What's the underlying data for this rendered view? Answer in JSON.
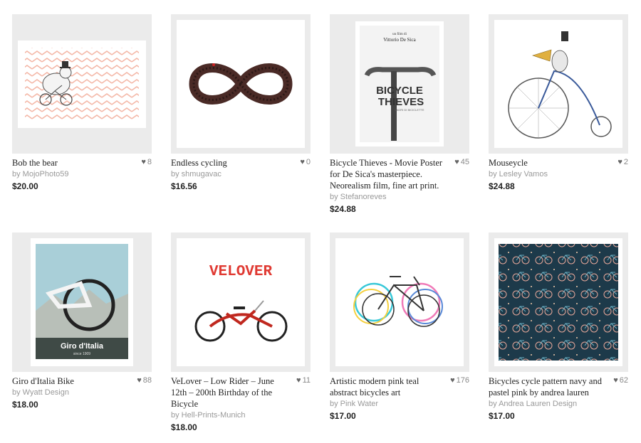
{
  "products": [
    {
      "title": "Bob the bear",
      "artist": "by MojoPhoto59",
      "price": "$20.00",
      "likes": "8",
      "heart_icon": "heart-icon"
    },
    {
      "title": "Endless cycling",
      "artist": "by shmugavac",
      "price": "$16.56",
      "likes": "0",
      "heart_icon": "heart-icon"
    },
    {
      "title": "Bicycle Thieves - Movie Poster for De Sica's masterpiece. Neorealism film, fine art print.",
      "artist": "by Stefanoreves",
      "price": "$24.88",
      "likes": "45",
      "heart_icon": "heart-icon"
    },
    {
      "title": "Mouseycle",
      "artist": "by Lesley Vamos",
      "price": "$24.88",
      "likes": "2",
      "heart_icon": "heart-icon"
    },
    {
      "title": "Giro d'Italia Bike",
      "artist": "by Wyatt Design",
      "price": "$18.00",
      "likes": "88",
      "heart_icon": "heart-icon"
    },
    {
      "title": "VeLover – Low Rider – June 12th – 200th Birthday of the Bicycle",
      "artist": "by Hell-Prints-Munich",
      "price": "$18.00",
      "likes": "11",
      "heart_icon": "heart-icon"
    },
    {
      "title": "Artistic modern pink teal abstract bicycles art",
      "artist": "by Pink Water",
      "price": "$17.00",
      "likes": "176",
      "heart_icon": "heart-icon"
    },
    {
      "title": "Bicycles cycle pattern navy and pastel pink by andrea lauren",
      "artist": "by Andrea Lauren Design",
      "price": "$17.00",
      "likes": "62",
      "heart_icon": "heart-icon"
    }
  ],
  "art_text": {
    "thieves_credit": "un film di",
    "thieves_director": "Vittorio De Sica",
    "thieves_line1": "BICYCLE",
    "thieves_line2": "THIEVES",
    "thieves_sub": "LADRI DI BICICLETTE",
    "giro_title": "Giro d'Italia",
    "giro_since": "since 1909",
    "velover": "VELOVER"
  },
  "colors": {
    "thumb_bg": "#ebebeb",
    "chevron": "#f4b8a8",
    "velover_red": "#e03a33",
    "navy": "#1d3a4a",
    "giro_sky": "#a9cfd8"
  }
}
